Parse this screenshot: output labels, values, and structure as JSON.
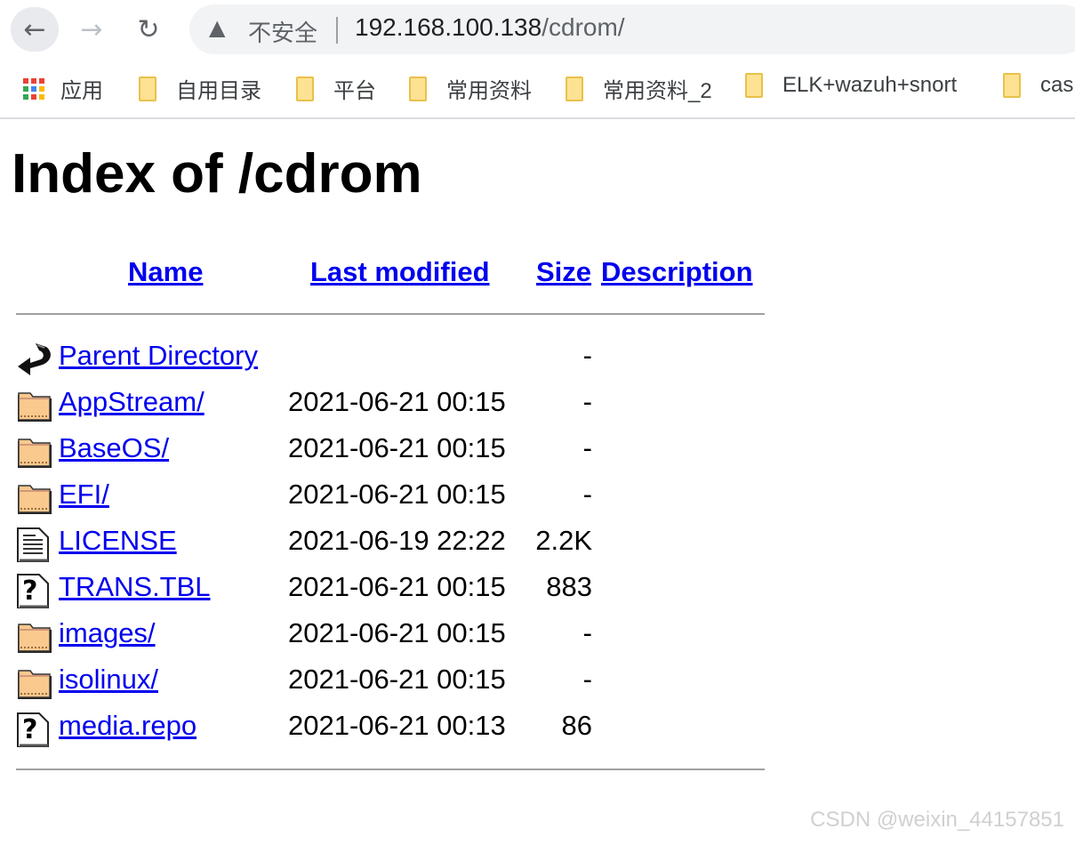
{
  "browser": {
    "security_label": "不安全",
    "url_host": "192.168.100.138",
    "url_path": "/cdrom/",
    "bookmarks": [
      {
        "label": "应用",
        "icon": "apps-grid-icon"
      },
      {
        "label": "自用目录",
        "icon": "folder-icon"
      },
      {
        "label": "平台",
        "icon": "folder-icon"
      },
      {
        "label": "常用资料",
        "icon": "folder-icon"
      },
      {
        "label": "常用资料_2",
        "icon": "folder-icon"
      },
      {
        "label": "ELK+wazuh+snort",
        "icon": "folder-icon"
      },
      {
        "label": "cas",
        "icon": "folder-icon"
      }
    ]
  },
  "page": {
    "title": "Index of /cdrom",
    "columns": {
      "name": "Name",
      "last_modified": "Last modified",
      "size": "Size",
      "description": "Description"
    },
    "entries": [
      {
        "name": "Parent Directory",
        "modified": "",
        "size": "-",
        "icon": "back-icon"
      },
      {
        "name": "AppStream/",
        "modified": "2021-06-21 00:15",
        "size": "-",
        "icon": "folder-icon"
      },
      {
        "name": "BaseOS/",
        "modified": "2021-06-21 00:15",
        "size": "-",
        "icon": "folder-icon"
      },
      {
        "name": "EFI/",
        "modified": "2021-06-21 00:15",
        "size": "-",
        "icon": "folder-icon"
      },
      {
        "name": "LICENSE",
        "modified": "2021-06-19 22:22",
        "size": "2.2K",
        "icon": "text-file-icon"
      },
      {
        "name": "TRANS.TBL",
        "modified": "2021-06-21 00:15",
        "size": "883",
        "icon": "unknown-file-icon"
      },
      {
        "name": "images/",
        "modified": "2021-06-21 00:15",
        "size": "-",
        "icon": "folder-icon"
      },
      {
        "name": "isolinux/",
        "modified": "2021-06-21 00:15",
        "size": "-",
        "icon": "folder-icon"
      },
      {
        "name": "media.repo",
        "modified": "2021-06-21 00:13",
        "size": "86",
        "icon": "unknown-file-icon"
      }
    ]
  },
  "watermark": "CSDN @weixin_44157851",
  "colors": {
    "link": "#0000ee",
    "folder": "#f9c98e"
  }
}
